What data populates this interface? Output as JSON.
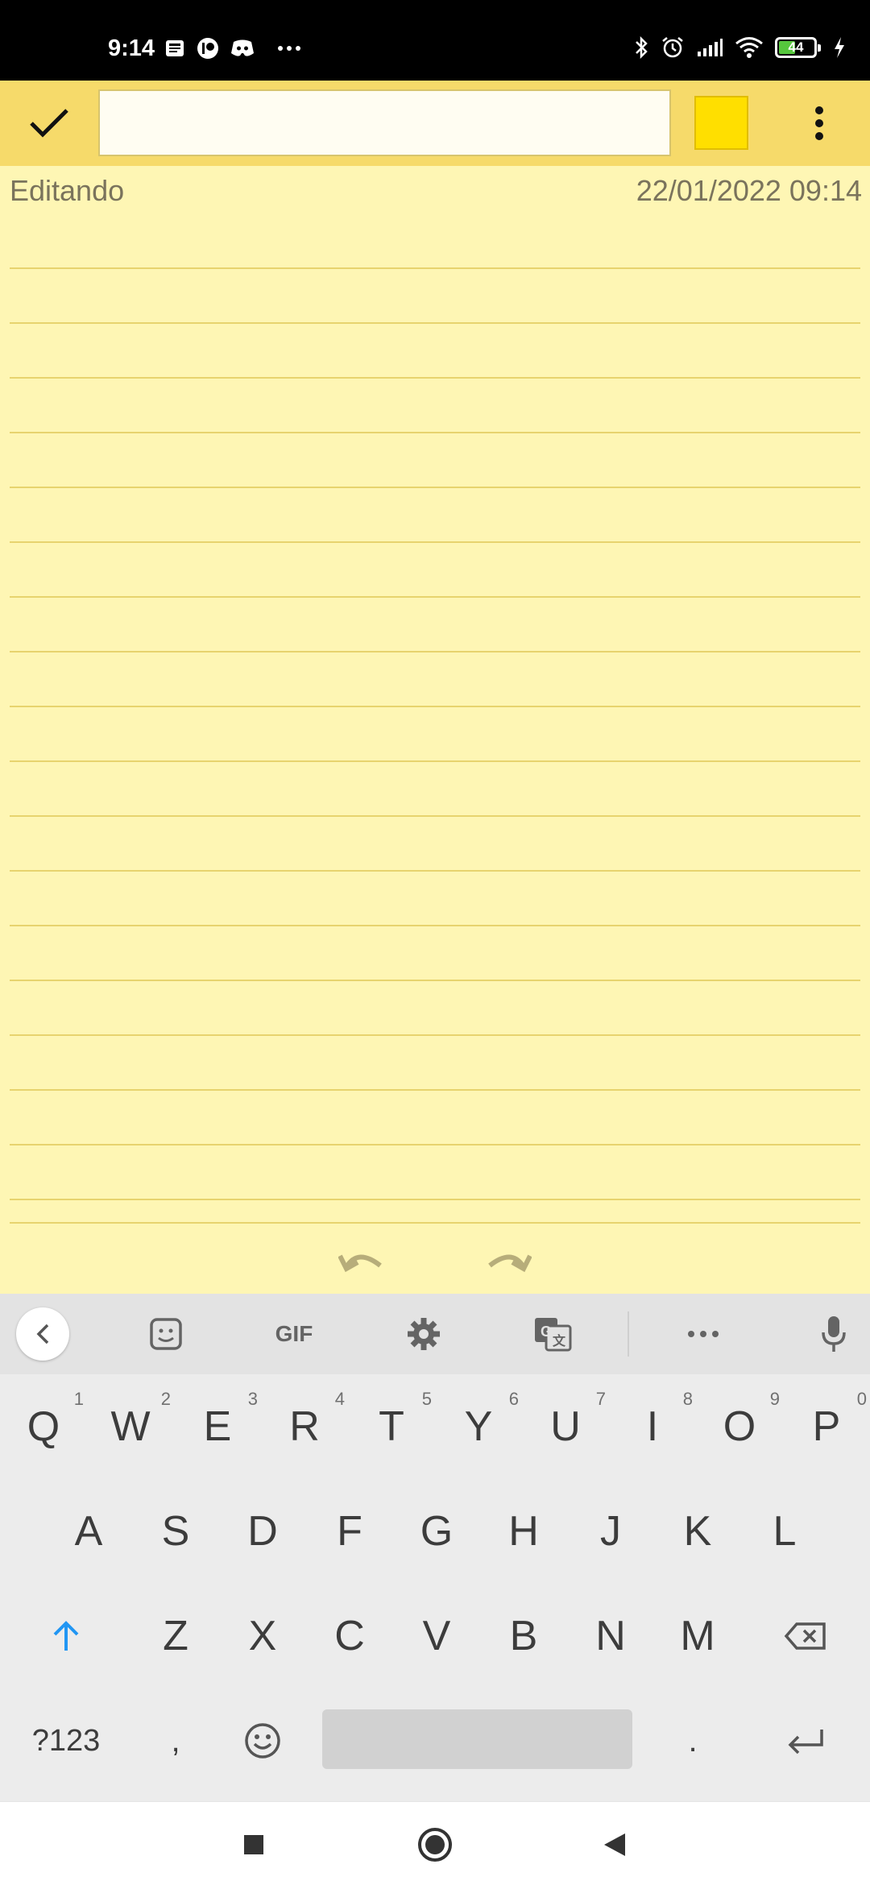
{
  "status_bar": {
    "time": "9:14",
    "battery_level": "44",
    "icons_left": [
      "news-icon",
      "patreon-icon",
      "discord-icon",
      "more-notifications-icon"
    ],
    "icons_right": [
      "bluetooth-icon",
      "alarm-icon",
      "signal-icon",
      "wifi-icon",
      "battery-icon",
      "charging-icon"
    ]
  },
  "toolbar": {
    "title_value": "",
    "title_placeholder": "",
    "note_color": "#ffdf00",
    "bar_color": "#f6da6a"
  },
  "note": {
    "mode": "Editando",
    "datetime": "22/01/2022 09:14",
    "body": "",
    "paper_color": "#fef6b4"
  },
  "keyboard": {
    "toolbar": {
      "gif_label": "GIF"
    },
    "row1": [
      {
        "label": "Q",
        "hint": "1"
      },
      {
        "label": "W",
        "hint": "2"
      },
      {
        "label": "E",
        "hint": "3"
      },
      {
        "label": "R",
        "hint": "4"
      },
      {
        "label": "T",
        "hint": "5"
      },
      {
        "label": "Y",
        "hint": "6"
      },
      {
        "label": "U",
        "hint": "7"
      },
      {
        "label": "I",
        "hint": "8"
      },
      {
        "label": "O",
        "hint": "9"
      },
      {
        "label": "P",
        "hint": "0"
      }
    ],
    "row2": [
      "A",
      "S",
      "D",
      "F",
      "G",
      "H",
      "J",
      "K",
      "L"
    ],
    "row3": [
      "Z",
      "X",
      "C",
      "V",
      "B",
      "N",
      "M"
    ],
    "row4": {
      "symbols_label": "?123",
      "comma_label": ",",
      "period_label": "."
    }
  }
}
